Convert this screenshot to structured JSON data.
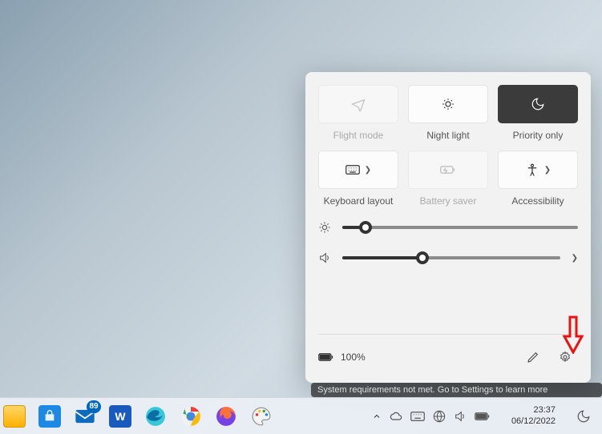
{
  "panel": {
    "tiles": [
      {
        "id": "flight-mode",
        "label": "Flight mode",
        "state": "disabled",
        "chevron": false
      },
      {
        "id": "night-light",
        "label": "Night light",
        "state": "off",
        "chevron": false
      },
      {
        "id": "priority-only",
        "label": "Priority only",
        "state": "active",
        "chevron": false
      },
      {
        "id": "keyboard-layout",
        "label": "Keyboard layout",
        "state": "off",
        "chevron": true
      },
      {
        "id": "battery-saver",
        "label": "Battery saver",
        "state": "disabled",
        "chevron": false
      },
      {
        "id": "accessibility",
        "label": "Accessibility",
        "state": "off",
        "chevron": true
      }
    ],
    "brightness_pct": 10,
    "volume_pct": 37,
    "battery_text": "100%"
  },
  "annotation": {
    "target": "settings-button"
  },
  "notification_fragment": "System requirements not met. Go to Settings to learn more",
  "taskbar": {
    "apps": [
      {
        "id": "file-explorer",
        "name": "file-explorer-icon"
      },
      {
        "id": "microsoft-store",
        "name": "store-icon"
      },
      {
        "id": "mail",
        "name": "mail-icon",
        "badge": "89"
      },
      {
        "id": "word",
        "name": "word-icon"
      },
      {
        "id": "edge",
        "name": "edge-icon"
      },
      {
        "id": "chrome",
        "name": "chrome-icon"
      },
      {
        "id": "firefox",
        "name": "firefox-icon"
      },
      {
        "id": "paint",
        "name": "paint-icon"
      }
    ],
    "tray": [
      {
        "id": "show-hidden",
        "name": "chevron-up-icon"
      },
      {
        "id": "onedrive",
        "name": "cloud-icon"
      },
      {
        "id": "keyboard",
        "name": "keyboard-icon"
      },
      {
        "id": "network",
        "name": "globe-icon"
      },
      {
        "id": "volume",
        "name": "volume-icon"
      },
      {
        "id": "battery",
        "name": "battery-icon"
      }
    ],
    "clock": {
      "time": "23:37",
      "date": "06/12/2022"
    }
  },
  "colors": {
    "accent": "#0067c0",
    "panel_bg": "#f2f2f2",
    "tile_active": "#3b3b3b"
  }
}
